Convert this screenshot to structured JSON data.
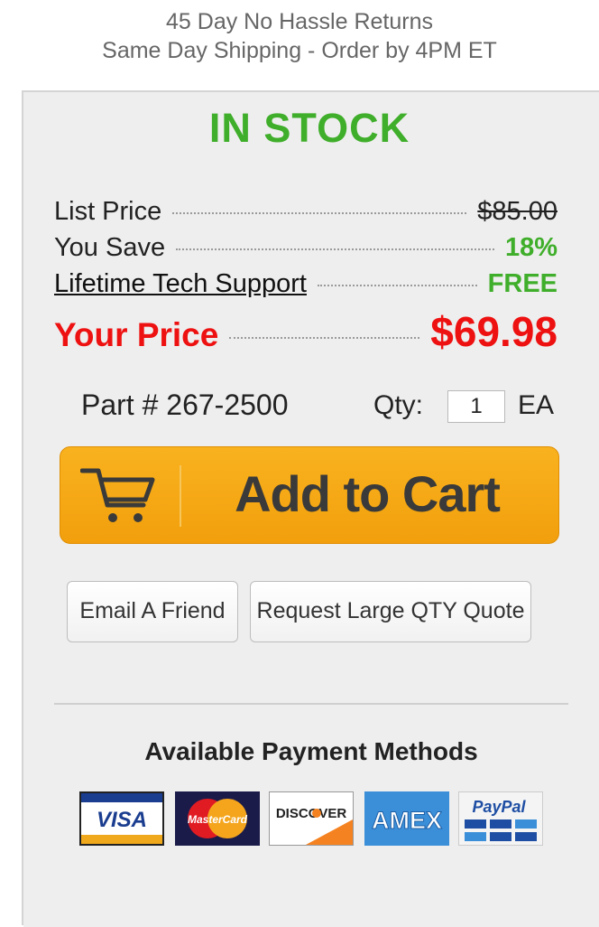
{
  "banner": {
    "line1": "45 Day No Hassle Returns",
    "line2": "Same Day Shipping - Order by 4PM ET"
  },
  "stock_status": "IN STOCK",
  "pricing": {
    "list_price_label": "List Price",
    "list_price_value": "$85.00",
    "you_save_label": "You Save",
    "you_save_value": "18%",
    "support_label": "Lifetime Tech Support",
    "support_value": "FREE",
    "your_price_label": "Your Price",
    "your_price_value": "$69.98"
  },
  "part": {
    "label": "Part # 267-2500"
  },
  "quantity": {
    "label": "Qty:",
    "value": "1",
    "unit": "EA"
  },
  "buttons": {
    "add_to_cart": "Add to Cart",
    "email_friend": "Email A Friend",
    "large_qty_quote": "Request Large QTY Quote"
  },
  "payment": {
    "title": "Available Payment Methods",
    "cards": [
      {
        "name": "VISA",
        "icon": "visa-card-icon"
      },
      {
        "name": "MasterCard",
        "icon": "mastercard-icon"
      },
      {
        "name": "DISCOVER",
        "icon": "discover-card-icon"
      },
      {
        "name": "AMEX",
        "icon": "amex-card-icon"
      },
      {
        "name": "PayPal",
        "icon": "paypal-icon"
      }
    ]
  },
  "colors": {
    "stock_green": "#3fae2a",
    "price_red": "#ee1111",
    "cart_orange": "#f5a916",
    "panel_bg": "#eeeeee"
  }
}
